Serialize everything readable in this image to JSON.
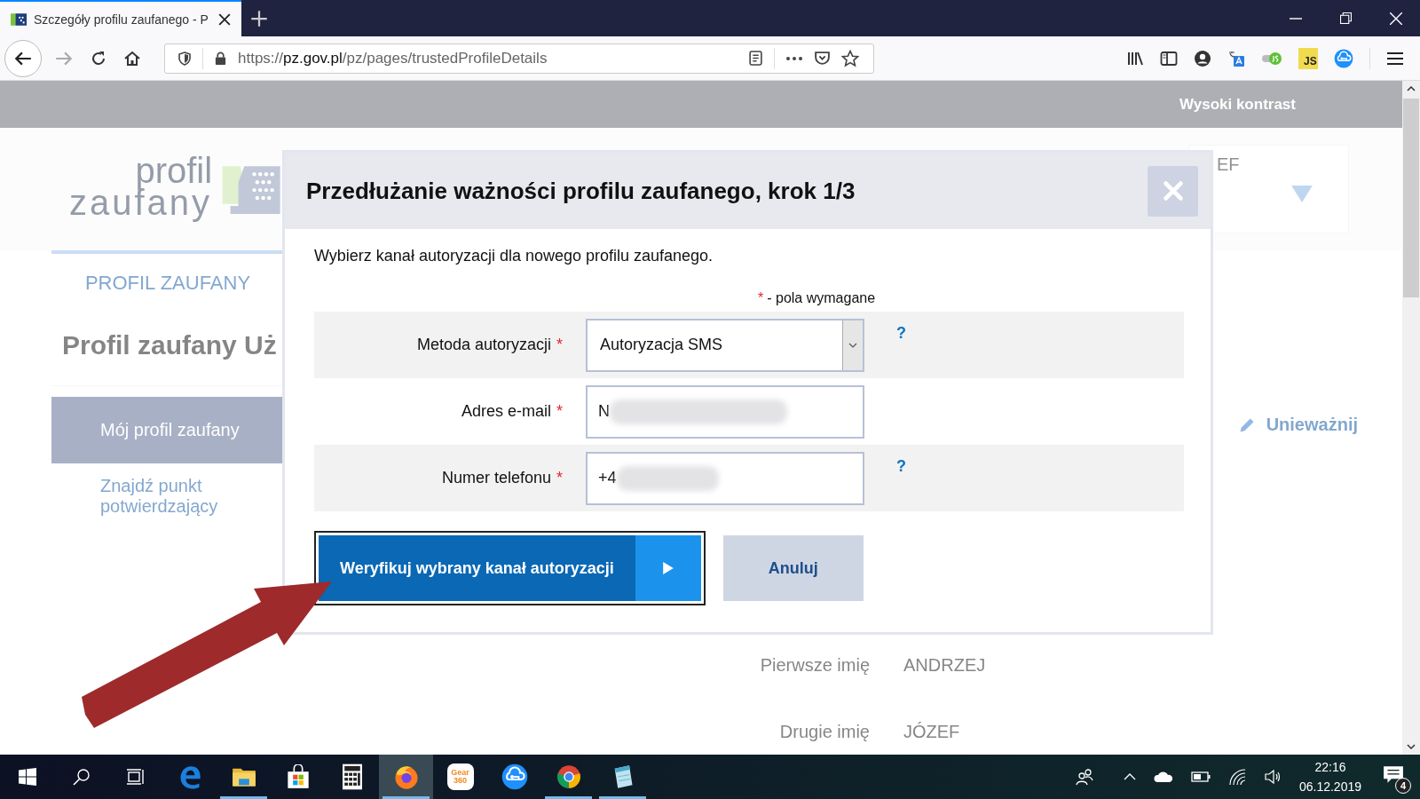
{
  "browser": {
    "tab": {
      "title": "Szczegóły profilu zaufanego - P",
      "selected": true
    },
    "url": {
      "scheme": "https://",
      "host": "pz.gov.pl",
      "path": "/pz/pages/trustedProfileDetails"
    },
    "extension_badge": "JS"
  },
  "page": {
    "contrast_link": "Wysoki kontrast",
    "logo": [
      "profil",
      "zaufany"
    ],
    "user_name_fragment": "EF",
    "nav_heading": "PROFIL ZAUFANY",
    "title": "Profil zaufany Uż",
    "menu": [
      {
        "label": "Mój profil zaufany",
        "selected": true
      },
      {
        "label": "Znajdź punkt potwierdzający",
        "selected": false
      }
    ],
    "action": "Unieważnij",
    "fields": [
      {
        "label": "Pierwsze imię",
        "value": "ANDRZEJ"
      },
      {
        "label": "Drugie imię",
        "value": "JÓZEF"
      }
    ]
  },
  "dialog": {
    "title": "Przedłużanie ważności profilu zaufanego, krok 1/3",
    "instruction": "Wybierz kanał autoryzacji dla nowego profilu zaufanego.",
    "required_note": {
      "mark": "*",
      "text": "- pola wymagane"
    },
    "rows": [
      {
        "kind": "select",
        "label": "Metoda autoryzacji",
        "mark": "*",
        "value": "Autoryzacja SMS",
        "help": "?"
      },
      {
        "kind": "input",
        "label": "Adres e-mail",
        "mark": "*",
        "value": "N",
        "redacted": true
      },
      {
        "kind": "input",
        "label": "Numer telefonu",
        "mark": "*",
        "value": "+4",
        "help": "?",
        "redacted": true
      }
    ],
    "primary_button": {
      "label": "Weryfikuj wybrany kanał autoryzacji",
      "focused": true
    },
    "cancel_button": "Anuluj"
  },
  "taskbar": {
    "apps": [
      {
        "kind": "edge",
        "running": false,
        "selected": false
      },
      {
        "kind": "folder",
        "running": true,
        "selected": false
      },
      {
        "kind": "store",
        "running": false,
        "selected": false
      },
      {
        "kind": "calculator",
        "running": false,
        "selected": false
      },
      {
        "kind": "firefox",
        "running": true,
        "selected": true
      },
      {
        "kind": "gear",
        "running": false,
        "selected": false,
        "label": [
          "Gear",
          "360"
        ]
      },
      {
        "kind": "cloudkey",
        "running": false,
        "selected": false
      },
      {
        "kind": "chrome",
        "running": true,
        "selected": false
      },
      {
        "kind": "notepad",
        "running": true,
        "selected": false
      }
    ],
    "time": "22:16",
    "date": "06.12.2019",
    "notifications": "4"
  }
}
